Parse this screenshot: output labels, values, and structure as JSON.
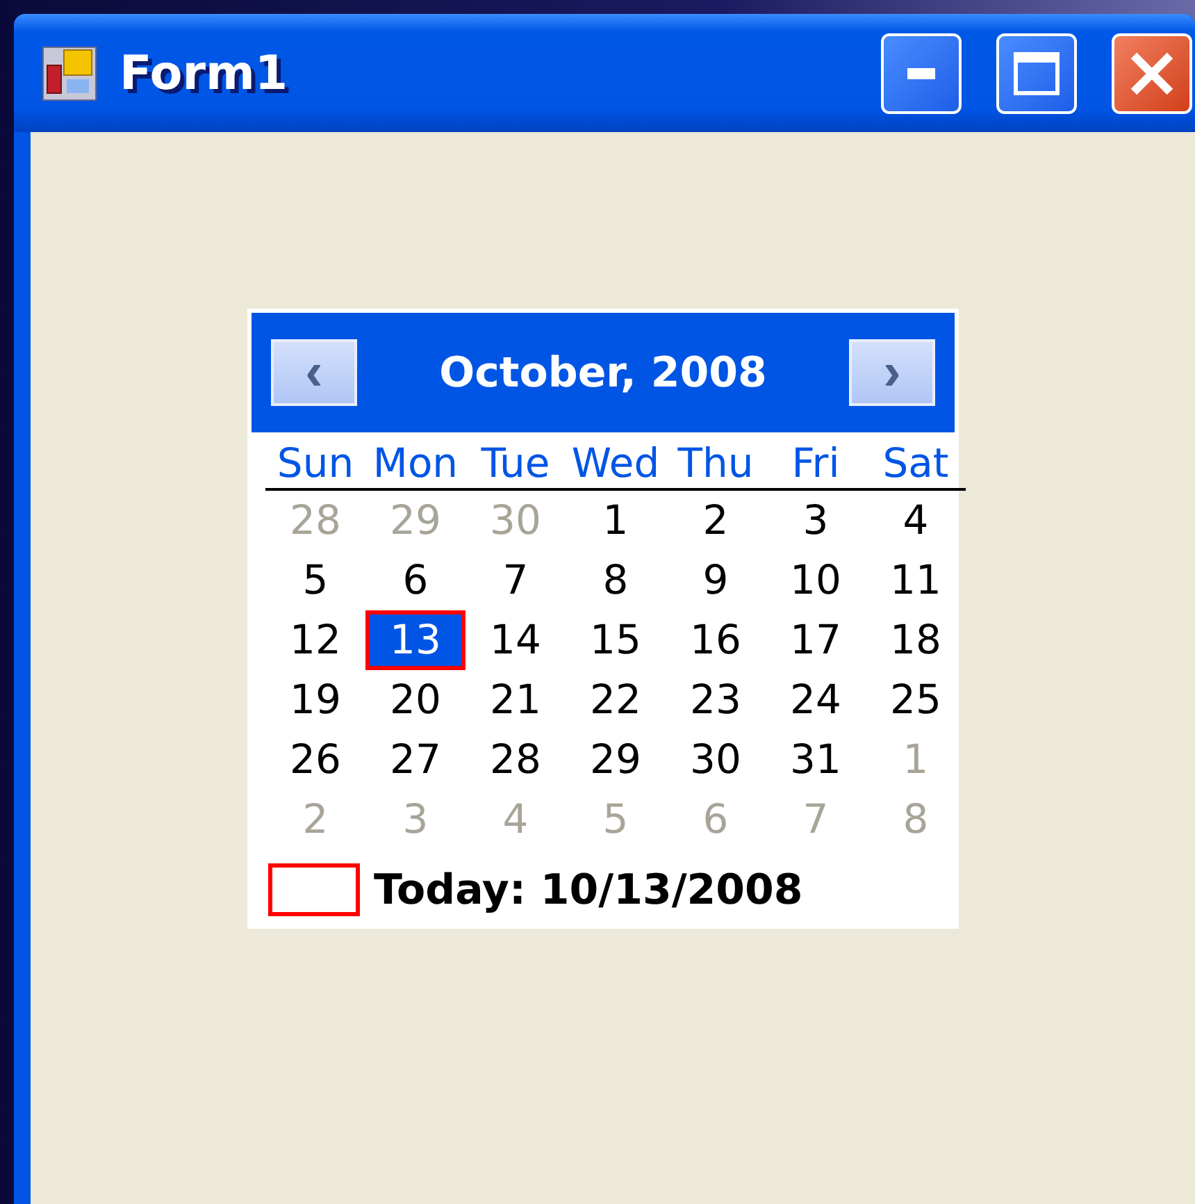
{
  "window": {
    "title": "Form1",
    "buttons": [
      {
        "kind": "minimize"
      },
      {
        "kind": "maximize"
      },
      {
        "kind": "close"
      }
    ]
  },
  "calendar": {
    "month": "October, 2008",
    "prev": "‹",
    "next": "›",
    "weekdays": [
      "Sun",
      "Mon",
      "Tue",
      "Wed",
      "Thu",
      "Fri",
      "Sat"
    ],
    "weeks": [
      [
        {
          "day": "28",
          "muted": true,
          "selected": false
        },
        {
          "day": "29",
          "muted": true,
          "selected": false
        },
        {
          "day": "30",
          "muted": true,
          "selected": false
        },
        {
          "day": "1",
          "muted": false,
          "selected": false
        },
        {
          "day": "2",
          "muted": false,
          "selected": false
        },
        {
          "day": "3",
          "muted": false,
          "selected": false
        },
        {
          "day": "4",
          "muted": false,
          "selected": false
        }
      ],
      [
        {
          "day": "5",
          "muted": false,
          "selected": false
        },
        {
          "day": "6",
          "muted": false,
          "selected": false
        },
        {
          "day": "7",
          "muted": false,
          "selected": false
        },
        {
          "day": "8",
          "muted": false,
          "selected": false
        },
        {
          "day": "9",
          "muted": false,
          "selected": false
        },
        {
          "day": "10",
          "muted": false,
          "selected": false
        },
        {
          "day": "11",
          "muted": false,
          "selected": false
        }
      ],
      [
        {
          "day": "12",
          "muted": false,
          "selected": false
        },
        {
          "day": "13",
          "muted": false,
          "selected": true
        },
        {
          "day": "14",
          "muted": false,
          "selected": false
        },
        {
          "day": "15",
          "muted": false,
          "selected": false
        },
        {
          "day": "16",
          "muted": false,
          "selected": false
        },
        {
          "day": "17",
          "muted": false,
          "selected": false
        },
        {
          "day": "18",
          "muted": false,
          "selected": false
        }
      ],
      [
        {
          "day": "19",
          "muted": false,
          "selected": false
        },
        {
          "day": "20",
          "muted": false,
          "selected": false
        },
        {
          "day": "21",
          "muted": false,
          "selected": false
        },
        {
          "day": "22",
          "muted": false,
          "selected": false
        },
        {
          "day": "23",
          "muted": false,
          "selected": false
        },
        {
          "day": "24",
          "muted": false,
          "selected": false
        },
        {
          "day": "25",
          "muted": false,
          "selected": false
        }
      ],
      [
        {
          "day": "26",
          "muted": false,
          "selected": false
        },
        {
          "day": "27",
          "muted": false,
          "selected": false
        },
        {
          "day": "28",
          "muted": false,
          "selected": false
        },
        {
          "day": "29",
          "muted": false,
          "selected": false
        },
        {
          "day": "30",
          "muted": false,
          "selected": false
        },
        {
          "day": "31",
          "muted": false,
          "selected": false
        },
        {
          "day": "1",
          "muted": true,
          "selected": false
        }
      ],
      [
        {
          "day": "2",
          "muted": true,
          "selected": false
        },
        {
          "day": "3",
          "muted": true,
          "selected": false
        },
        {
          "day": "4",
          "muted": true,
          "selected": false
        },
        {
          "day": "5",
          "muted": true,
          "selected": false
        },
        {
          "day": "6",
          "muted": true,
          "selected": false
        },
        {
          "day": "7",
          "muted": true,
          "selected": false
        },
        {
          "day": "8",
          "muted": true,
          "selected": false
        }
      ]
    ],
    "today": "Today: 10/13/2008"
  }
}
